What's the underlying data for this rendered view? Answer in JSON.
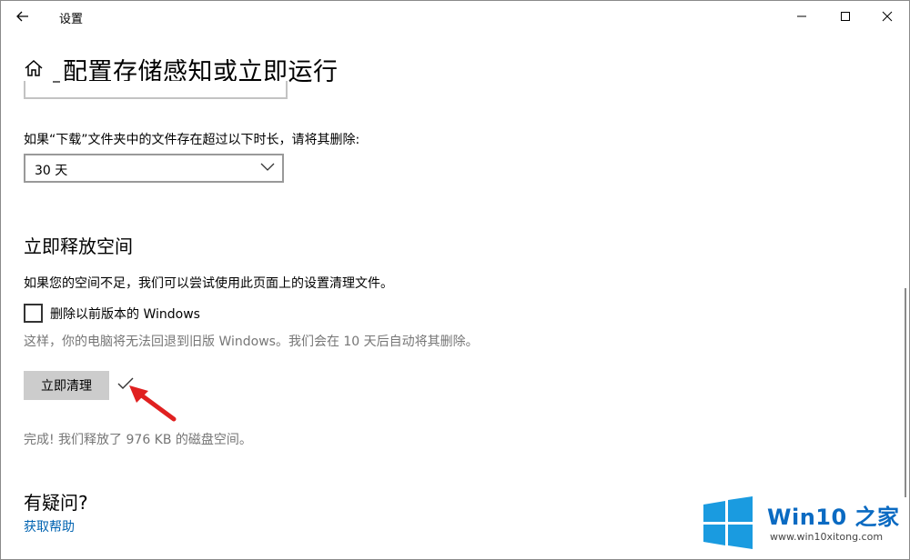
{
  "window": {
    "title": "设置"
  },
  "header": {
    "title": "配置存储感知或立即运行"
  },
  "downloads": {
    "label": "如果“下载”文件夹中的文件存在超过以下时长，请将其删除:",
    "selected": "30 天"
  },
  "free_space": {
    "heading": "立即释放空间",
    "description": "如果您的空间不足，我们可以尝试使用此页面上的设置清理文件。",
    "checkbox_label": "删除以前版本的 Windows",
    "checkbox_checked": false,
    "checkbox_hint": "这样，你的电脑将无法回退到旧版 Windows。我们会在 10 天后自动将其删除。",
    "button_label": "立即清理",
    "result": "完成! 我们释放了 976 KB 的磁盘空间。"
  },
  "help": {
    "heading": "有疑问?",
    "link": "获取帮助"
  },
  "watermark": {
    "title": "Win10 之家",
    "url": "www.win10xitong.com"
  },
  "colors": {
    "accent": "#0063b1",
    "button_bg": "#cccccc",
    "hint_text": "#767676",
    "arrow": "#e02020",
    "watermark_blue": "#0a6ac2"
  }
}
